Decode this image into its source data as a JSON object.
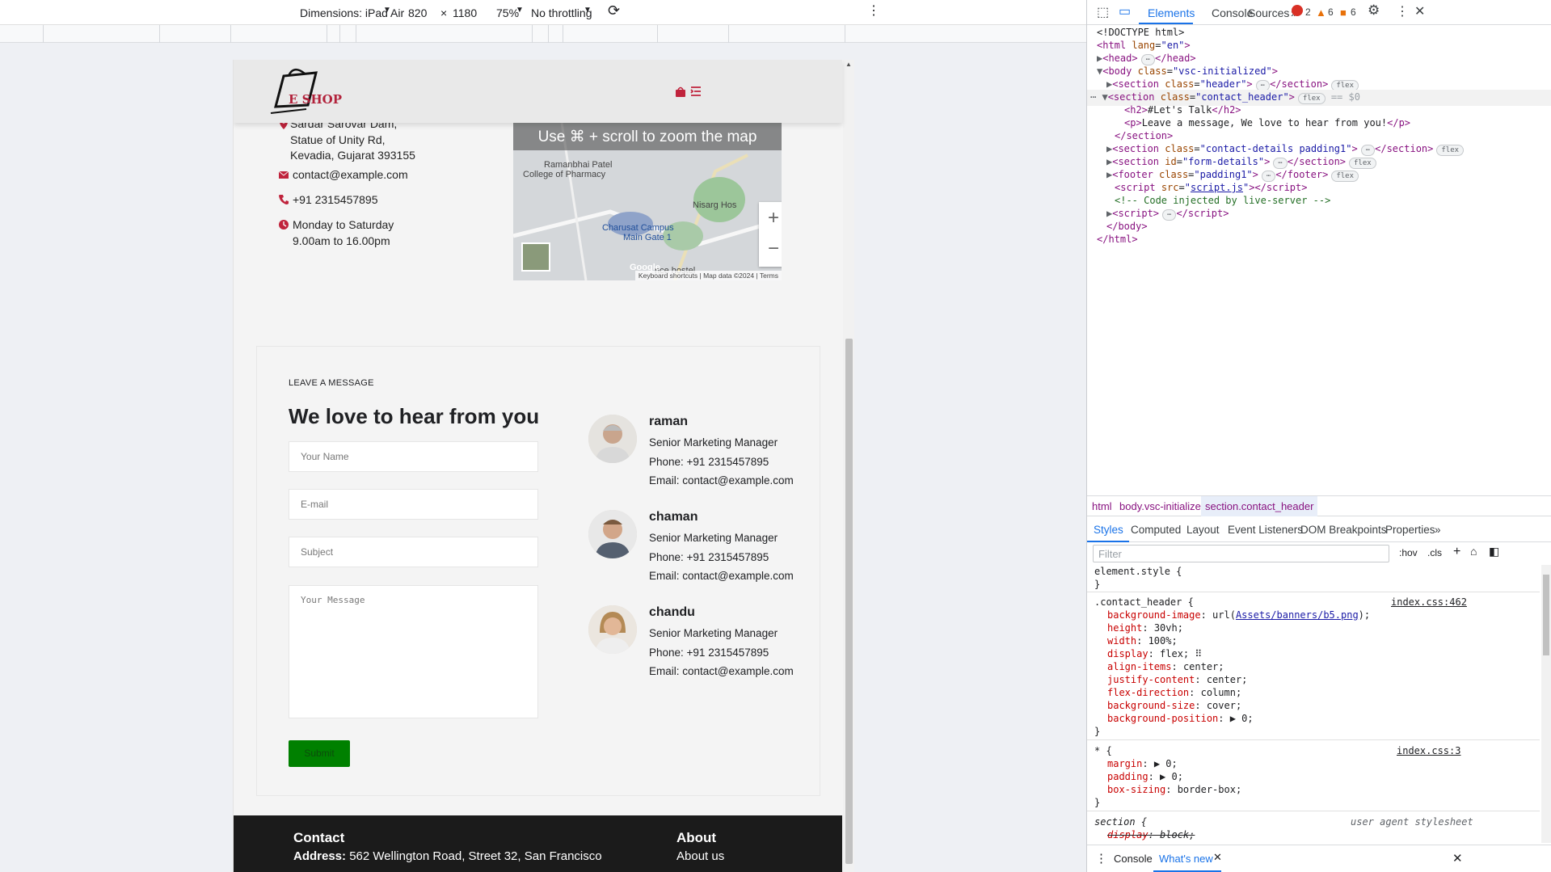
{
  "toolbar": {
    "dimensions_label": "Dimensions: iPad Air",
    "width": "820",
    "times": "×",
    "height": "1180",
    "zoom": "75%",
    "throttling": "No throttling"
  },
  "site": {
    "logo_text": "E SHOP",
    "contact_info": {
      "address": "Sardar Sarovar Dam, Statue of Unity Rd, Kevadia, Gujarat 393155",
      "email": "contact@example.com",
      "phone": "+91 2315457895",
      "hours": "Monday to Saturday 9.00am to 16.00pm"
    },
    "map": {
      "banner": "Use ⌘ + scroll to zoom the map",
      "labels": [
        "Ramanbhai Patel",
        "College of Pharmacy",
        "Charusat Campus",
        "Main Gate 1",
        "Nisarg Hos",
        "nce hostel",
        "Google"
      ],
      "footer": [
        "Keyboard shortcuts",
        "Map data ©2024",
        "Terms"
      ]
    },
    "message": {
      "kicker": "LEAVE A MESSAGE",
      "title": "We love to hear from you",
      "name_placeholder": "Your Name",
      "email_placeholder": "E-mail",
      "subject_placeholder": "Subject",
      "message_placeholder": "Your Message",
      "submit": "Submit"
    },
    "people": [
      {
        "name": "raman",
        "role": "Senior Marketing Manager",
        "phone": "Phone: +91 2315457895",
        "email": "Email: contact@example.com"
      },
      {
        "name": "chaman",
        "role": "Senior Marketing Manager",
        "phone": "Phone: +91 2315457895",
        "email": "Email: contact@example.com"
      },
      {
        "name": "chandu",
        "role": "Senior Marketing Manager",
        "phone": "Phone: +91 2315457895",
        "email": "Email: contact@example.com"
      }
    ],
    "footer": {
      "contact_heading": "Contact",
      "address_label": "Address:",
      "address": "562 Wellington Road, Street 32, San Francisco",
      "about_heading": "About",
      "about_link": "About us"
    }
  },
  "devtools": {
    "tabs": [
      "Elements",
      "Console",
      "Sources"
    ],
    "counts": {
      "errors": "2",
      "warnings": "6",
      "issues": "6"
    },
    "dom": {
      "doctype": "<!DOCTYPE html>",
      "eq": "== $0",
      "h2": "#Let's Talk",
      "p": "Leave a message, We love to hear from you!",
      "comment": "<!-- Code injected by live-server -->",
      "script_src": "script.js"
    },
    "breadcrumb": [
      "html",
      "body.vsc-initialized",
      "section.contact_header"
    ],
    "style_tabs": [
      "Styles",
      "Computed",
      "Layout",
      "Event Listeners",
      "DOM Breakpoints",
      "Properties"
    ],
    "filter_placeholder": "Filter",
    "hov": ":hov",
    "cls": ".cls",
    "rules": {
      "element_style": "element.style {",
      "contact_selector": ".contact_header {",
      "contact_src": "index.css:462",
      "universal_selector": "* {",
      "universal_src": "index.css:3",
      "section_selector": "section {",
      "ua": "user agent stylesheet"
    },
    "drawer": [
      "Console",
      "What's new"
    ]
  }
}
